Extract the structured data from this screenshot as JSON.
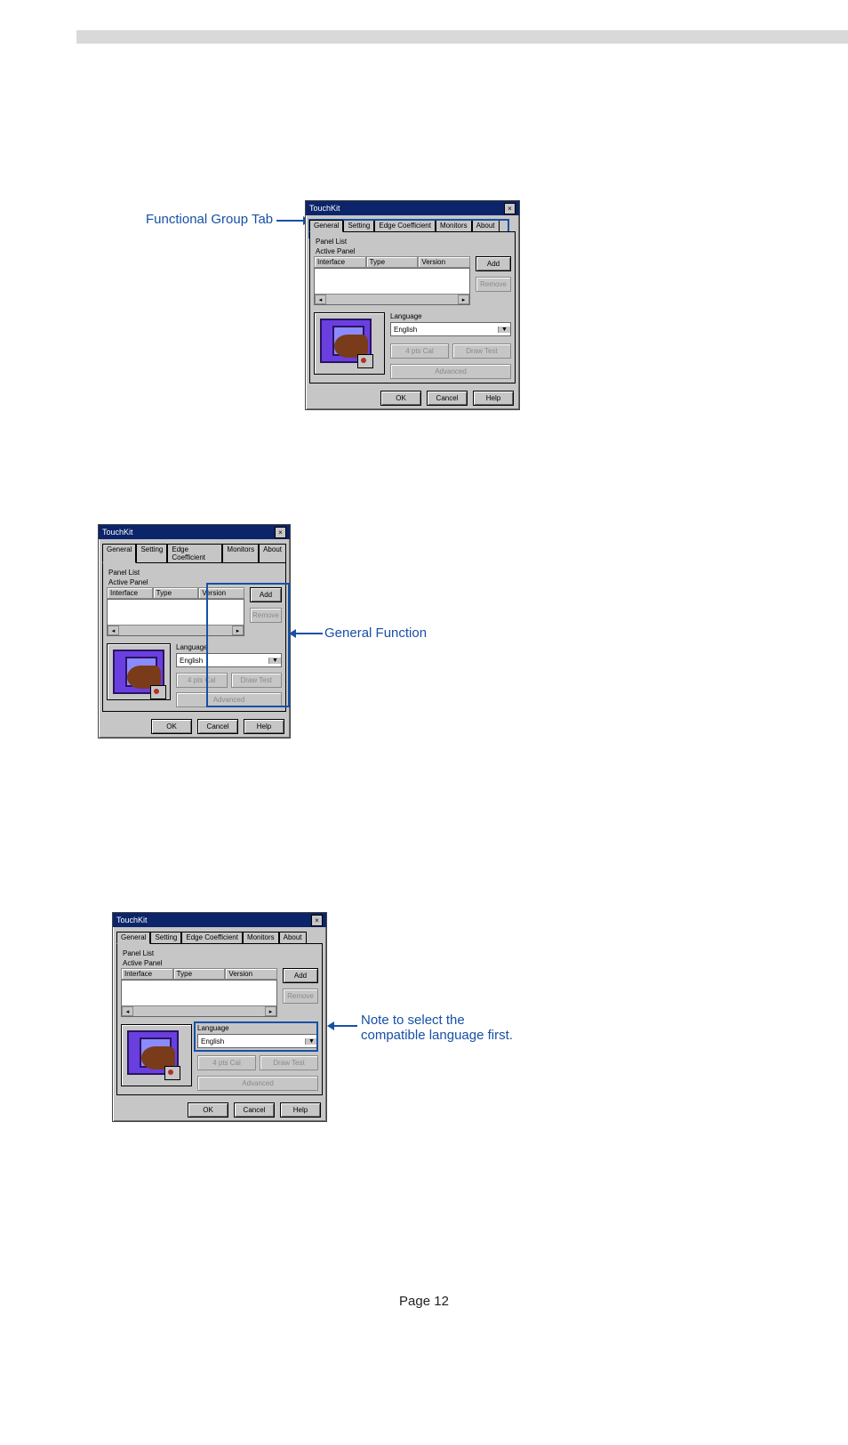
{
  "page_footer": "Page 12",
  "callouts": {
    "functional_tab": "Functional Group Tab",
    "general_function": "General Function",
    "language_note_l1": "Note to select the",
    "language_note_l2": "compatible language first."
  },
  "dialog": {
    "title": "TouchKit",
    "tabs": [
      "General",
      "Setting",
      "Edge Coefficient",
      "Monitors",
      "About"
    ],
    "panel_list_label": "Panel List",
    "active_panel_label": "Active Panel",
    "columns": [
      "Interface",
      "Type",
      "Version"
    ],
    "side_buttons": {
      "add": "Add",
      "remove": "Remove"
    },
    "language_label": "Language",
    "language_value": "English",
    "cal_buttons": {
      "four": "4 pts Cal",
      "draw": "Draw Test",
      "advanced": "Advanced"
    },
    "bottom": {
      "ok": "OK",
      "cancel": "Cancel",
      "help": "Help"
    }
  }
}
